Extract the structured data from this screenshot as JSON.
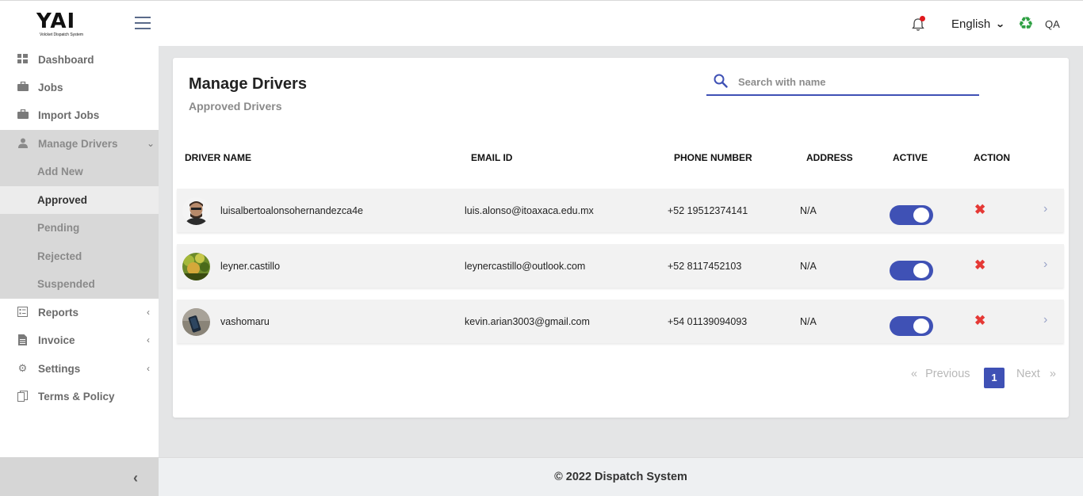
{
  "brand": {
    "logo_text": "YAI",
    "logo_subtitle": "Volcket Dispatch System"
  },
  "header": {
    "language": "English",
    "user_initials": "QA"
  },
  "sidebar": {
    "items": [
      {
        "label": "Dashboard",
        "icon": "dashboard-icon"
      },
      {
        "label": "Jobs",
        "icon": "briefcase-icon"
      },
      {
        "label": "Import Jobs",
        "icon": "briefcase-icon"
      },
      {
        "label": "Manage Drivers",
        "icon": "user-icon"
      },
      {
        "label": "Reports",
        "icon": "report-icon"
      },
      {
        "label": "Invoice",
        "icon": "invoice-icon"
      },
      {
        "label": "Settings",
        "icon": "gear-icon"
      },
      {
        "label": "Terms & Policy",
        "icon": "copy-icon"
      }
    ],
    "sub_items": [
      {
        "label": "Add New"
      },
      {
        "label": "Approved"
      },
      {
        "label": "Pending"
      },
      {
        "label": "Rejected"
      },
      {
        "label": "Suspended"
      }
    ]
  },
  "main": {
    "title": "Manage Drivers",
    "subtitle": "Approved Drivers",
    "search_placeholder": "Search with name",
    "columns": [
      "DRIVER NAME",
      "EMAIL ID",
      "PHONE NUMBER",
      "ADDRESS",
      "ACTIVE",
      "ACTION"
    ],
    "rows": [
      {
        "name": "luisalbertoalonsohernandezca4e",
        "email": "luis.alonso@itoaxaca.edu.mx",
        "phone": "+52 19512374141",
        "address": "N/A",
        "active": true
      },
      {
        "name": "leyner.castillo",
        "email": "leynercastillo@outlook.com",
        "phone": "+52 8117452103",
        "address": "N/A",
        "active": true
      },
      {
        "name": "vashomaru",
        "email": "kevin.arian3003@gmail.com",
        "phone": "+54 01139094093",
        "address": "N/A",
        "active": true
      }
    ],
    "pagination": {
      "previous": "Previous",
      "current": "1",
      "next": "Next"
    }
  },
  "footer": {
    "text": "© 2022 Dispatch System"
  },
  "colors": {
    "accent": "#3f51b5",
    "danger": "#e53935",
    "notification": "#e0191d"
  }
}
